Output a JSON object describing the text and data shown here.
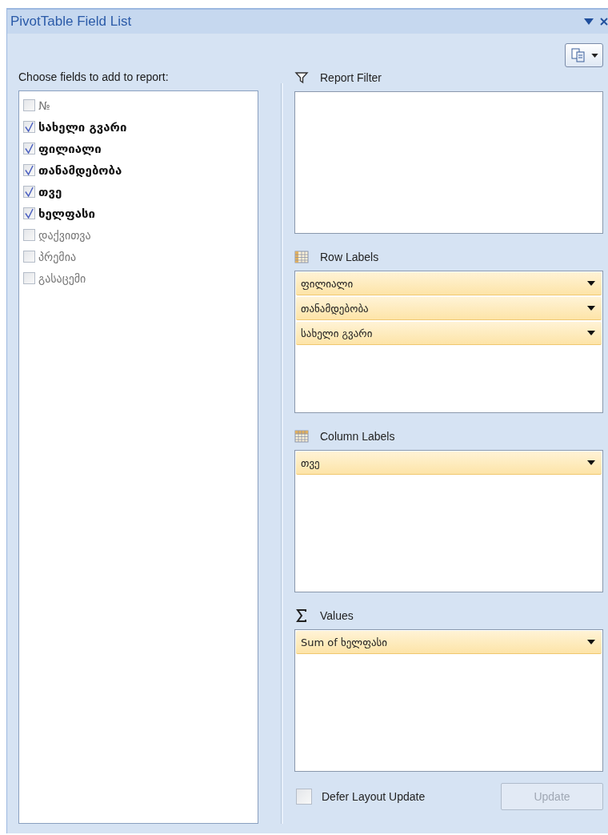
{
  "panel": {
    "title": "PivotTable Field List"
  },
  "field_section": {
    "label": "Choose fields to add to report:"
  },
  "fields": [
    {
      "name": "№",
      "checked": false
    },
    {
      "name": "სახელი გვარი",
      "checked": true
    },
    {
      "name": "ფილიალი",
      "checked": true
    },
    {
      "name": "თანამდებობა",
      "checked": true
    },
    {
      "name": "თვე",
      "checked": true
    },
    {
      "name": "ხელფასი",
      "checked": true
    },
    {
      "name": "დაქვითვა",
      "checked": false
    },
    {
      "name": "პრემია",
      "checked": false
    },
    {
      "name": "გასაცემი",
      "checked": false
    }
  ],
  "areas": [
    {
      "kind": "filter",
      "label": "Report Filter"
    },
    {
      "kind": "rows",
      "label": "Row Labels",
      "items": [
        "ფილიალი",
        "თანამდებობა",
        "სახელი გვარი"
      ]
    },
    {
      "kind": "columns",
      "label": "Column Labels",
      "items": [
        "თვე"
      ]
    },
    {
      "kind": "values",
      "label": "Values",
      "items": [
        "Sum of ხელფასი"
      ]
    }
  ],
  "defer_update": {
    "label": "Defer Layout Update",
    "checked": false
  },
  "update_button": {
    "label": "Update",
    "disabled": true
  }
}
